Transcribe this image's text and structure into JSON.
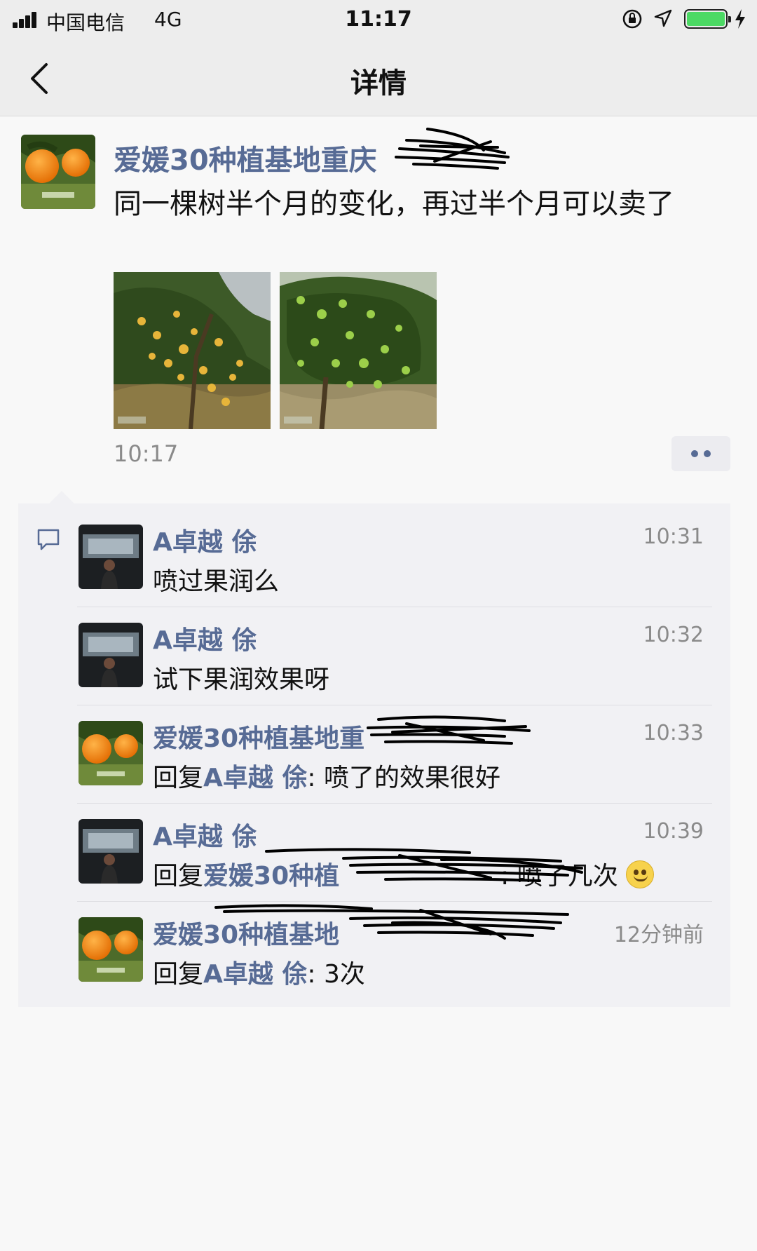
{
  "status_bar": {
    "carrier": "中国电信",
    "network": "4G",
    "time": "11:17",
    "icons": [
      "signal-icon",
      "rotation-lock-icon",
      "location-icon",
      "battery-icon",
      "charging-icon"
    ]
  },
  "nav": {
    "back_icon": "chevron-left-icon",
    "title": "详情"
  },
  "post": {
    "author": "爱媛30种植基地重庆",
    "text": "同一棵树半个月的变化，再过半个月可以卖了",
    "time": "10:17",
    "images": [
      "orange-tree-photo-1",
      "orange-tree-photo-2"
    ]
  },
  "comments": [
    {
      "name": "A卓越 俆",
      "time": "10:31",
      "text": "喷过果润么"
    },
    {
      "name": "A卓越 俆",
      "time": "10:32",
      "text": "试下果润效果呀"
    },
    {
      "name": "爱媛30种植基地重",
      "time": "10:33",
      "reply_prefix": "回复",
      "reply_to": "A卓越 俆",
      "text": ": 喷了的效果很好"
    },
    {
      "name": "A卓越 俆",
      "time": "10:39",
      "reply_prefix": "回复",
      "reply_to": "爱媛30种植",
      "text": ": 喷了几次",
      "emoji": "smile-emoji"
    },
    {
      "name": "爱媛30种植基地",
      "time": "12分钟前",
      "reply_prefix": "回复",
      "reply_to": "A卓越 俆",
      "text": ": 3次"
    }
  ],
  "colors": {
    "link_blue": "#576b95",
    "bar_gray": "#ededed",
    "comment_bg": "#f1f1f4",
    "battery_green": "#4cd964"
  }
}
